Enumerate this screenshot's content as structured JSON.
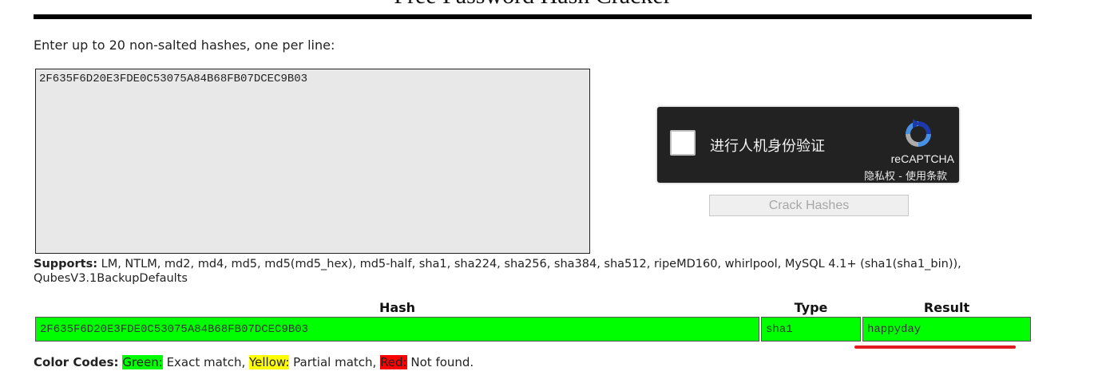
{
  "page": {
    "title": "Free Password Hash Cracker",
    "instructions": "Enter up to 20 non-salted hashes, one per line:"
  },
  "hash_input": {
    "value": "2F635F6D20E3FDE0C53075A84B68FB07DCEC9B03"
  },
  "captcha": {
    "label": "进行人机身份验证",
    "brand": "reCAPTCHA",
    "privacy": "隐私权",
    "separator": " - ",
    "terms": "使用条款",
    "logo_icon": "recaptcha-logo-icon"
  },
  "crack_button": {
    "label": "Crack Hashes"
  },
  "supports": {
    "label": "Supports:",
    "text": " LM, NTLM, md2, md4, md5, md5(md5_hex), md5-half, sha1, sha224, sha256, sha384, sha512, ripeMD160, whirlpool, MySQL 4.1+ (sha1(sha1_bin)), QubesV3.1BackupDefaults"
  },
  "results": {
    "columns": {
      "hash": "Hash",
      "type": "Type",
      "result": "Result"
    },
    "rows": [
      {
        "hash": "2F635F6D20E3FDE0C53075A84B68FB07DCEC9B03",
        "type": "sha1",
        "result": "happyday",
        "status_color": "#00ff00"
      }
    ]
  },
  "color_codes": {
    "label": "Color Codes:",
    "green_label": "Green:",
    "green_text": " Exact match, ",
    "yellow_label": "Yellow:",
    "yellow_text": " Partial match, ",
    "red_label": "Red:",
    "red_text": " Not found.",
    "green": "#00ff00",
    "yellow": "#ffff00",
    "red": "#ff0000"
  },
  "annotation": {
    "underline_color": "#e11b22"
  }
}
